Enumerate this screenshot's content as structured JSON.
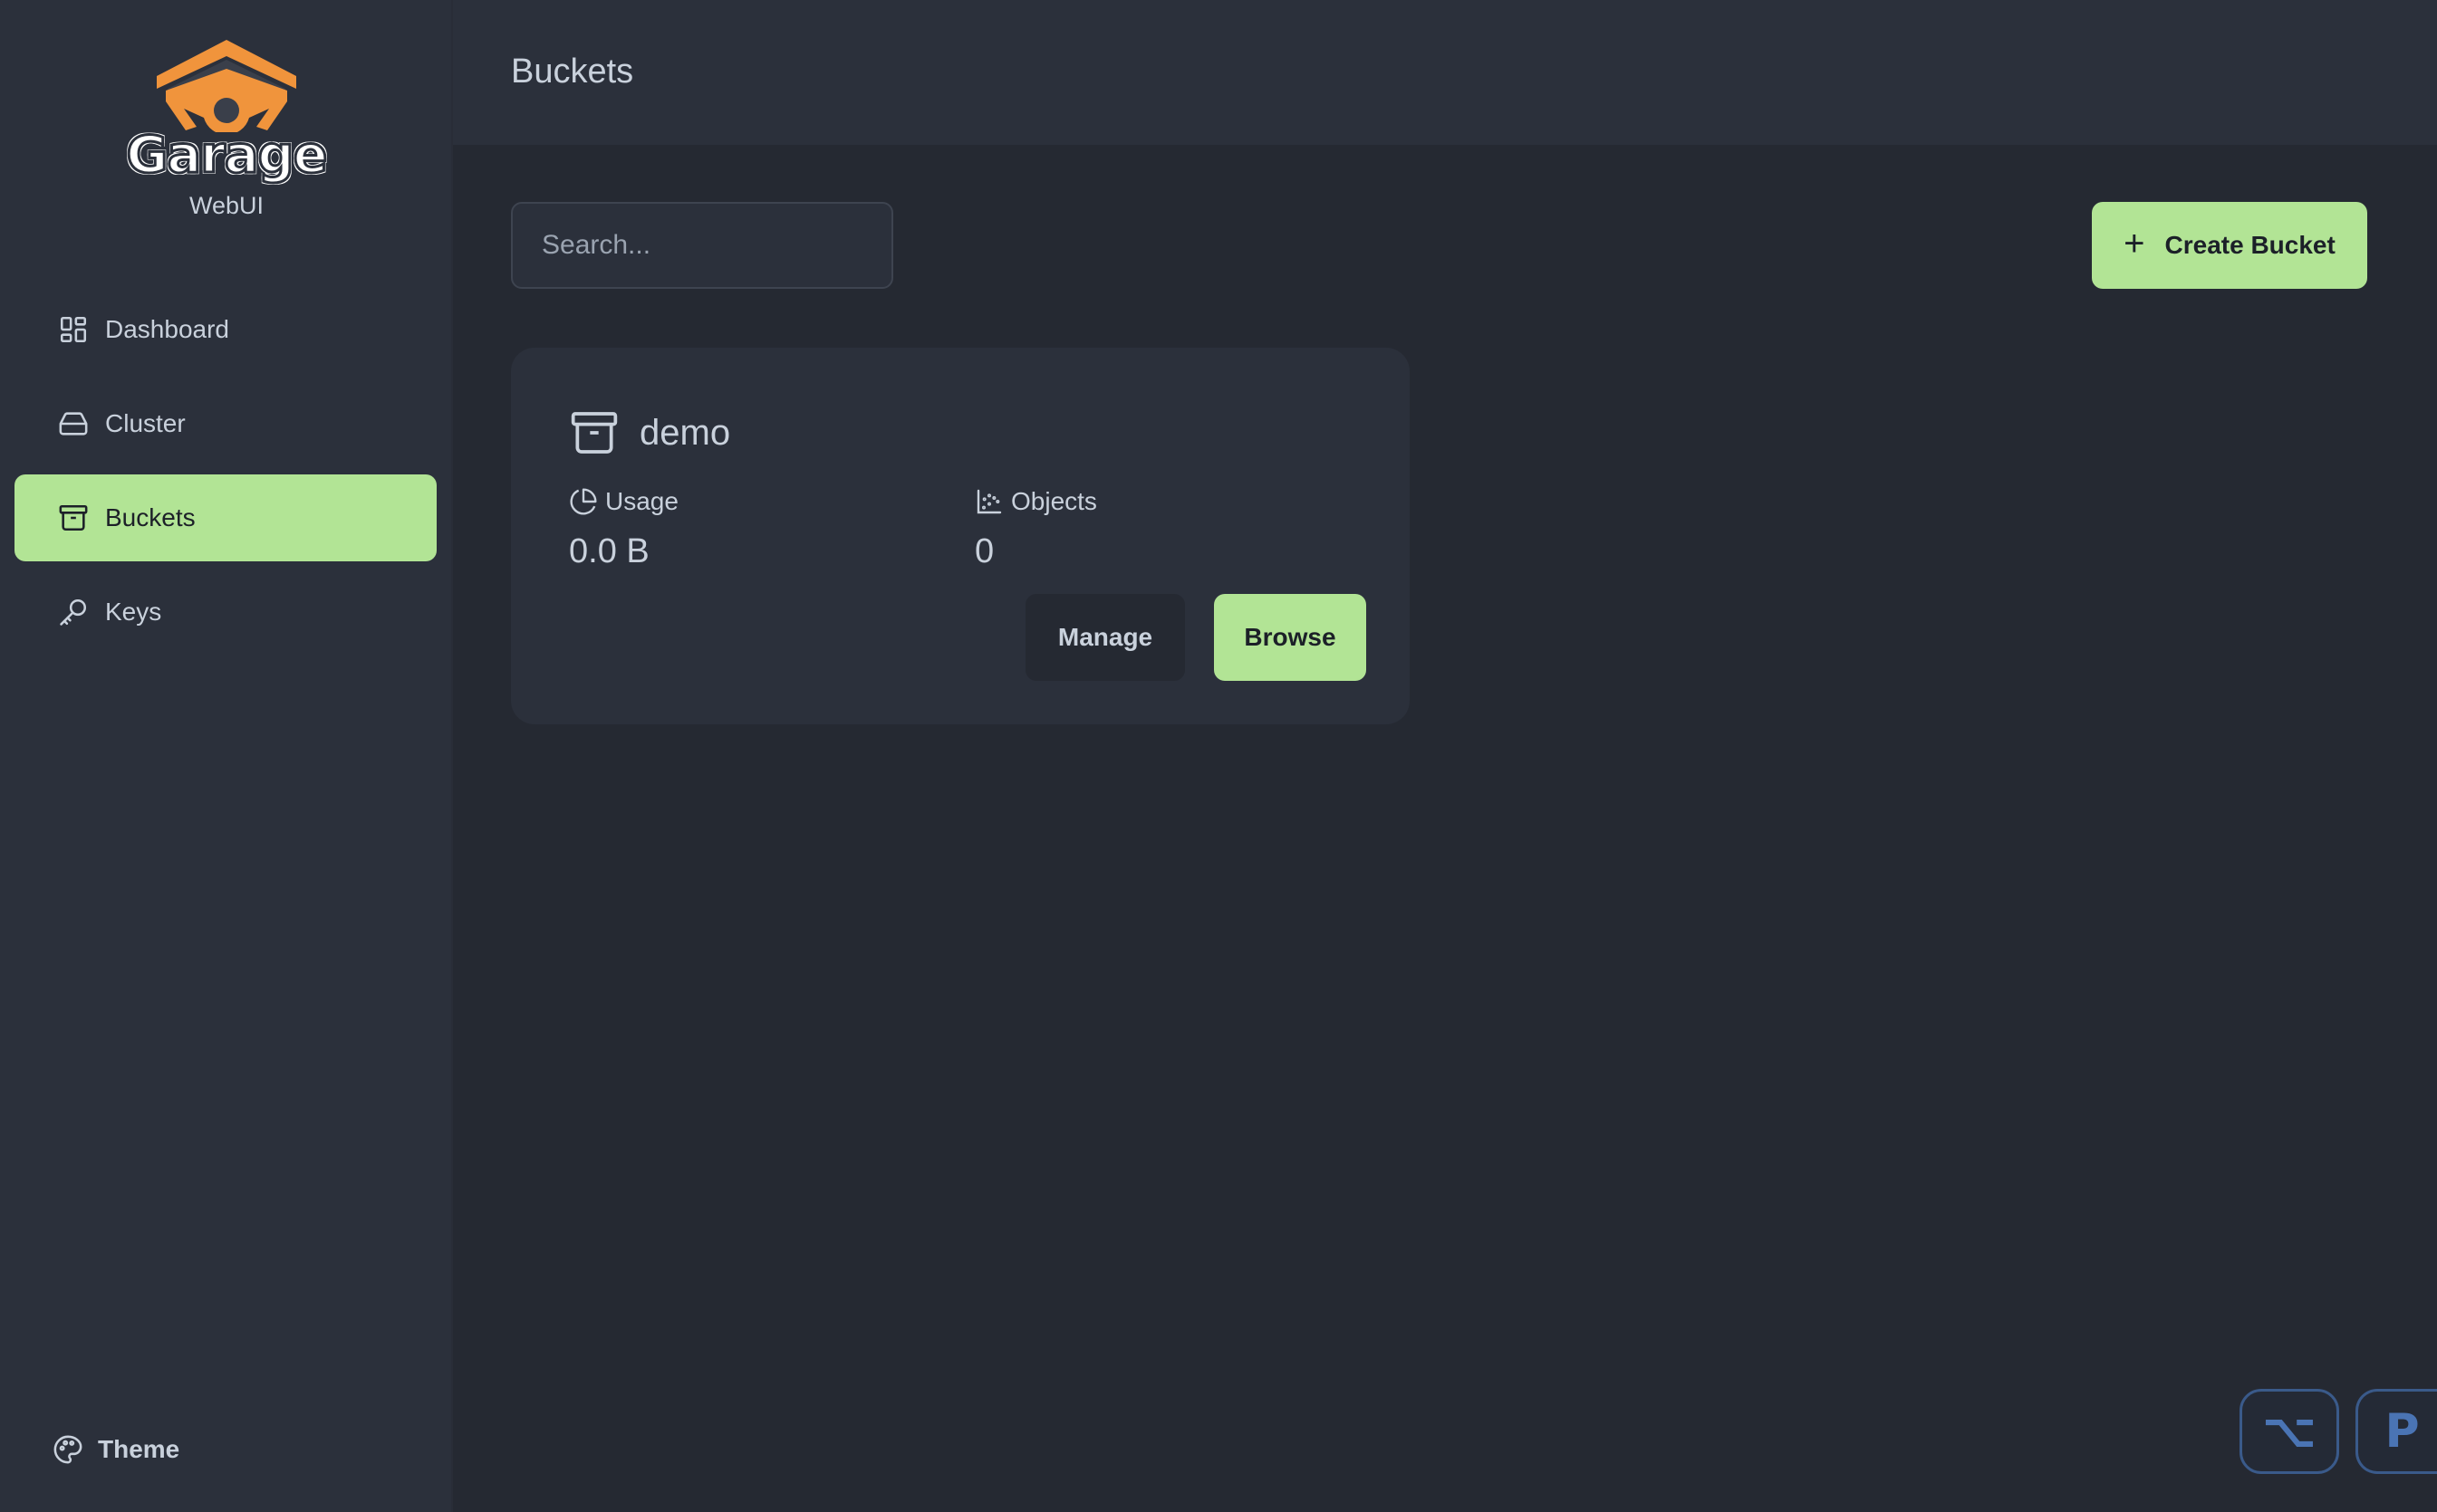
{
  "app": {
    "logo_word": "Garage",
    "logo_subtitle": "WebUI"
  },
  "sidebar": {
    "items": [
      {
        "label": "Dashboard",
        "icon": "dashboard-grid-icon",
        "active": false
      },
      {
        "label": "Cluster",
        "icon": "hard-drive-icon",
        "active": false
      },
      {
        "label": "Buckets",
        "icon": "archive-box-icon",
        "active": true
      },
      {
        "label": "Keys",
        "icon": "key-icon",
        "active": false
      }
    ],
    "theme_label": "Theme"
  },
  "header": {
    "title": "Buckets"
  },
  "toolbar": {
    "search_placeholder": "Search...",
    "create_label": "Create Bucket",
    "create_icon": "plus-icon"
  },
  "buckets": [
    {
      "name": "demo",
      "usage_label": "Usage",
      "usage_value": "0.0 B",
      "objects_label": "Objects",
      "objects_value": "0",
      "manage_label": "Manage",
      "browse_label": "Browse"
    }
  ],
  "corner": {
    "badge_1": "⌥",
    "badge_2": "P"
  },
  "colors": {
    "accent": "#b2e495",
    "background": "#252932",
    "panel": "#2b303b",
    "logo_orange": "#f0943c",
    "badge_blue": "#4a74b4"
  }
}
